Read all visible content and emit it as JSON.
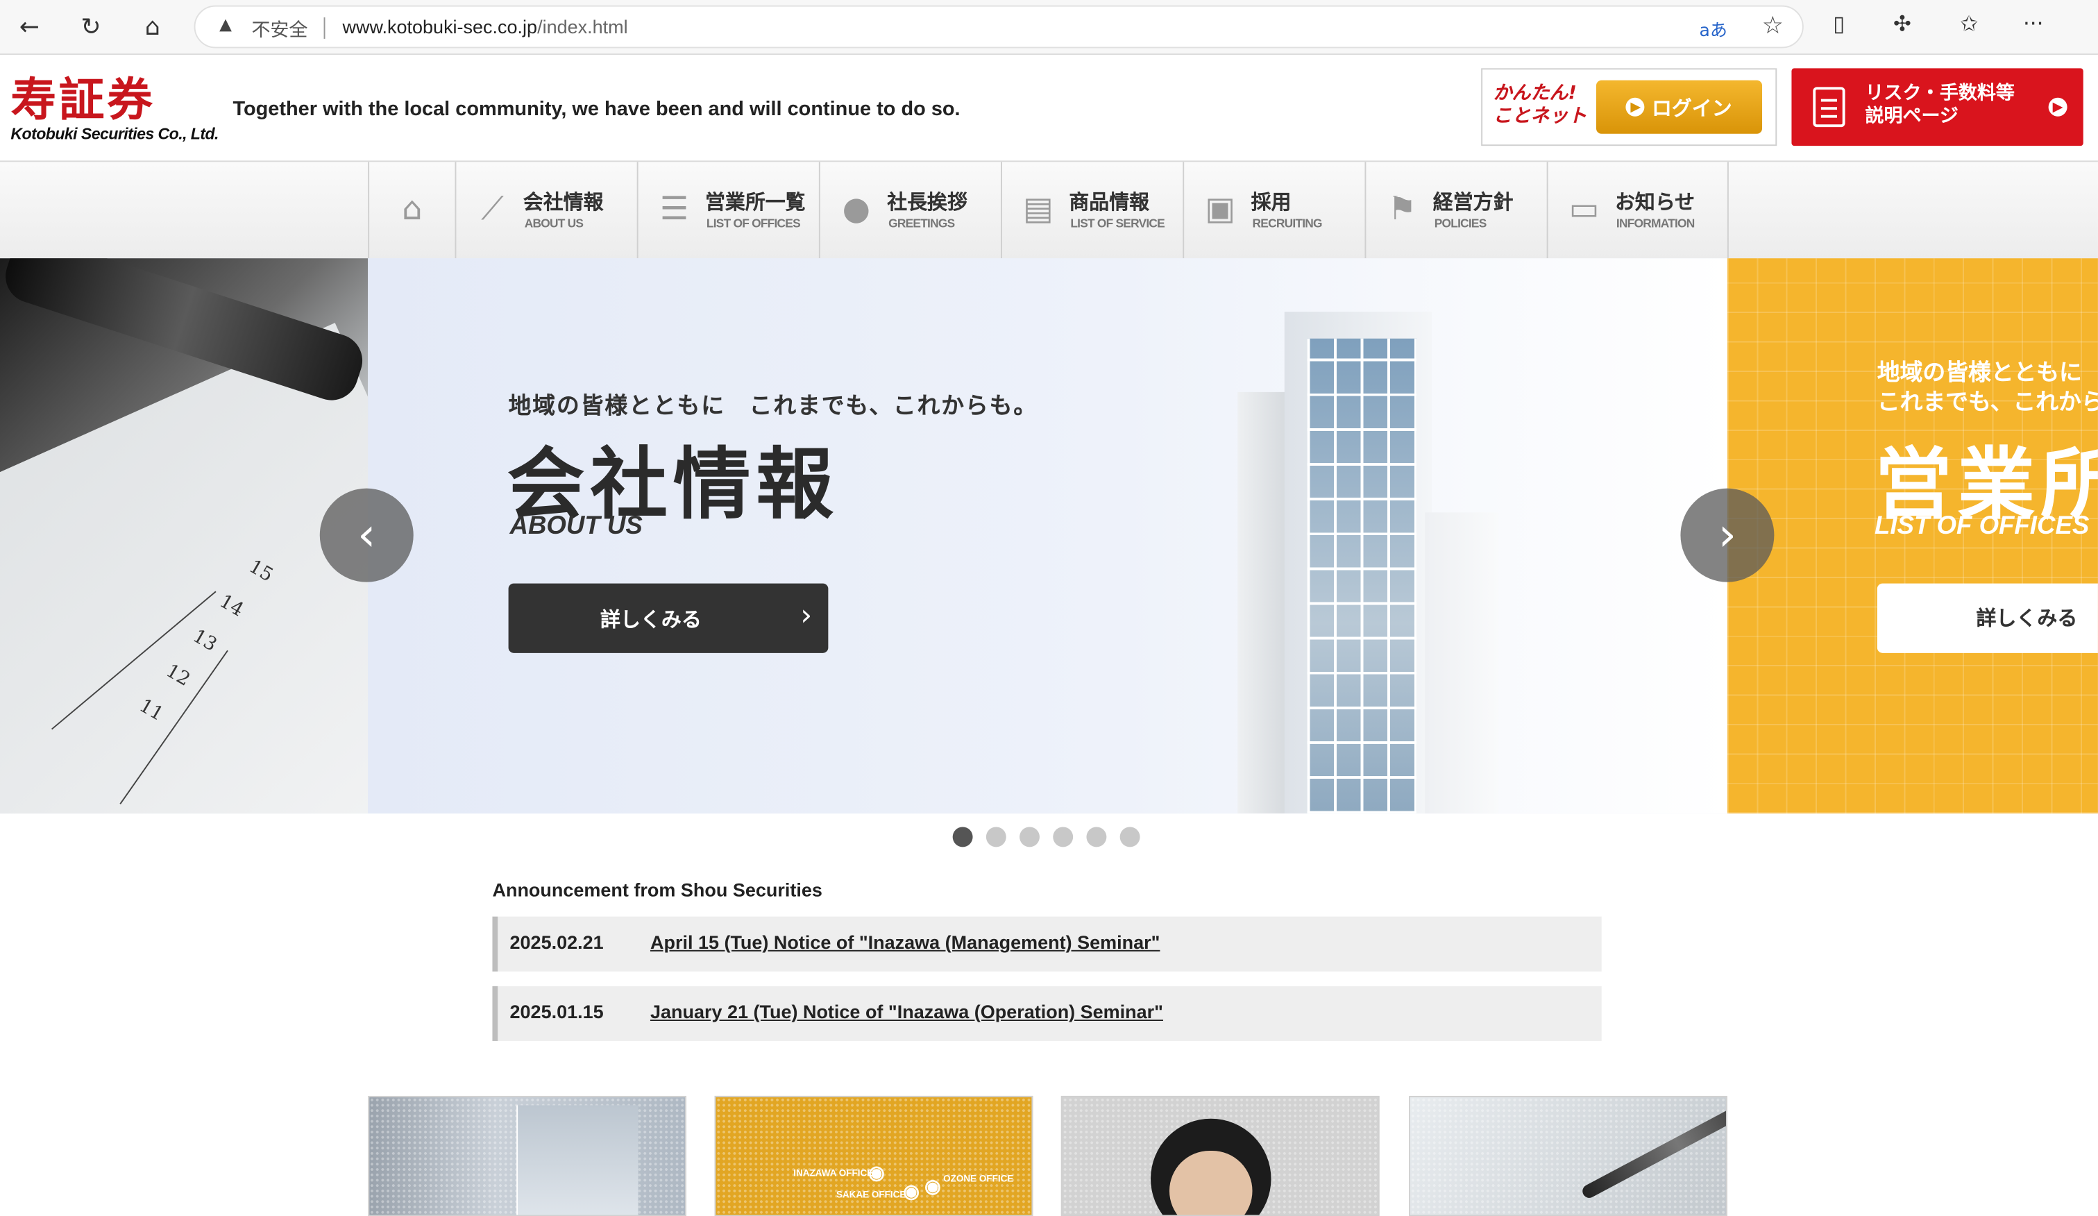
{
  "browser": {
    "security_label": "不安全",
    "url_host": "www.kotobuki-sec.co.jp",
    "url_path": "/index.html"
  },
  "header": {
    "logo_kanji": "寿証券",
    "logo_en": "Kotobuki Securities Co., Ltd.",
    "tagline": "Together with the local community, we have been and will continue to do so.",
    "kantan_label_line1": "かんたん!",
    "kantan_label_line2": "ことネット",
    "login_label": "ログイン",
    "risk_line1": "リスク・手数料等",
    "risk_line2": "説明ページ"
  },
  "nav": {
    "items": [
      {
        "jp": "会社情報",
        "en": "ABOUT US"
      },
      {
        "jp": "営業所一覧",
        "en": "LIST OF OFFICES"
      },
      {
        "jp": "社長挨拶",
        "en": "GREETINGS"
      },
      {
        "jp": "商品情報",
        "en": "LIST OF SERVICE"
      },
      {
        "jp": "採用",
        "en": "RECRUITING"
      },
      {
        "jp": "経営方針",
        "en": "POLICIES"
      },
      {
        "jp": "お知らせ",
        "en": "INFORMATION"
      }
    ]
  },
  "carousel": {
    "main": {
      "kicker": "地域の皆様とともに　これまでも、これからも。",
      "title": "会社情報",
      "subtitle": "ABOUT US",
      "button": "詳しくみる"
    },
    "next": {
      "kicker_line1": "地域の皆様とともに",
      "kicker_line2": "これまでも、これから",
      "title": "営業所",
      "subtitle": "LIST OF OFFICES",
      "button": "詳しくみる"
    },
    "left_numbers": [
      "15",
      "14",
      "13",
      "12",
      "11"
    ],
    "dots": 6,
    "active_dot": 1
  },
  "announcements": {
    "title": "Announcement from Shou Securities",
    "items": [
      {
        "date": "2025.02.21",
        "text": "April 15 (Tue) Notice of \"Inazawa (Management) Seminar\""
      },
      {
        "date": "2025.01.15",
        "text": "January 21 (Tue) Notice of \"Inazawa (Operation) Seminar\""
      }
    ]
  },
  "cards": {
    "c2_labels": [
      "INAZAWA OFFICE",
      "OZONE OFFICE",
      "SAKAE OFFICE"
    ]
  },
  "colors": {
    "brand_red": "#c8161d",
    "login_orange": "#e6a317",
    "slide_orange": "#f5b52d"
  }
}
